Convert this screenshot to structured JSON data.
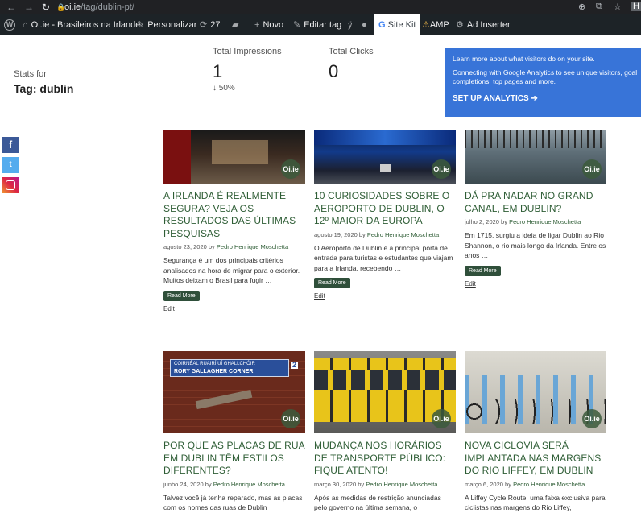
{
  "browser": {
    "url_domain": "oi.ie",
    "url_path": "/tag/dublin-pt/"
  },
  "admin_bar": {
    "site_name": "Oi.ie - Brasileiros na Irlande",
    "personalize": "Personalizar",
    "updates_count": "27",
    "new": "Novo",
    "edit_tag": "Editar tag",
    "site_kit": "Site Kit",
    "amp": "AMP",
    "ad_inserter": "Ad Inserter"
  },
  "stats": {
    "label": "Stats for",
    "tag": "Tag: dublin",
    "impressions_label": "Total Impressions",
    "impressions_value": "1",
    "impressions_delta": "↓ 50%",
    "clicks_label": "Total Clicks",
    "clicks_value": "0"
  },
  "analytics_promo": {
    "line1": "Learn more about what visitors do on your site.",
    "line2": "Connecting with Google Analytics to see unique visitors, goal",
    "line3": "completions, top pages and more.",
    "cta": "SET UP ANALYTICS ➔"
  },
  "posts": [
    {
      "title": "A Irlanda é realmente segura? Veja os resultados das últimas pesquisas",
      "date": "agosto 23, 2020",
      "by": "by",
      "author": "Pedro Henrique Moschetta",
      "excerpt": "Segurança é um dos principais critérios analisados na hora de migrar para o exterior. Muitos deixam o Brasil para fugir …",
      "read_more": "Read More",
      "edit": "Edit"
    },
    {
      "title": "10 curiosidades sobre o Aeroporto de Dublin, o 12º maior da Europa",
      "date": "agosto 19, 2020",
      "by": "by",
      "author": "Pedro Henrique Moschetta",
      "excerpt": "O Aeroporto de Dublin é a principal porta de entrada para turistas e estudantes que viajam para a Irlanda, recebendo …",
      "read_more": "Read More",
      "edit": "Edit"
    },
    {
      "title": "Dá pra nadar no Grand Canal, em Dublin?",
      "date": "julho 2, 2020",
      "by": "by",
      "author": "Pedro Henrique Moschetta",
      "excerpt": "Em 1715, surgiu a ideia de ligar Dublin ao Rio Shannon, o rio mais longo da Irlanda. Entre os anos …",
      "read_more": "Read More",
      "edit": "Edit"
    },
    {
      "title": "Por que as placas de rua em Dublin têm estilos diferentes?",
      "date": "junho 24, 2020",
      "by": "by",
      "author": "Pedro Henrique Moschetta",
      "excerpt": "Talvez você já tenha reparado, mas as placas com os nomes das ruas de Dublin",
      "sign_line1": "COIRNÉAL RUAIRÍ UÍ GHALLCHÓIR",
      "sign_line2": "RORY GALLAGHER CORNER",
      "sign_number": "2"
    },
    {
      "title": "Mudança nos horários de transporte público: fique atento!",
      "date": "março 30, 2020",
      "by": "by",
      "author": "Pedro Henrique Moschetta",
      "excerpt": "Após as medidas de restrição anunciadas pelo governo na última semana, o"
    },
    {
      "title": "Nova ciclovia será implantada nas margens do Rio Liffey, em Dublin",
      "date": "março 6, 2020",
      "by": "by",
      "author": "Pedro Henrique Moschetta",
      "excerpt": "A Liffey Cycle Route, uma faixa exclusiva para ciclistas nas margens do Rio Liffey,"
    }
  ],
  "watermark": "Oi.ie"
}
